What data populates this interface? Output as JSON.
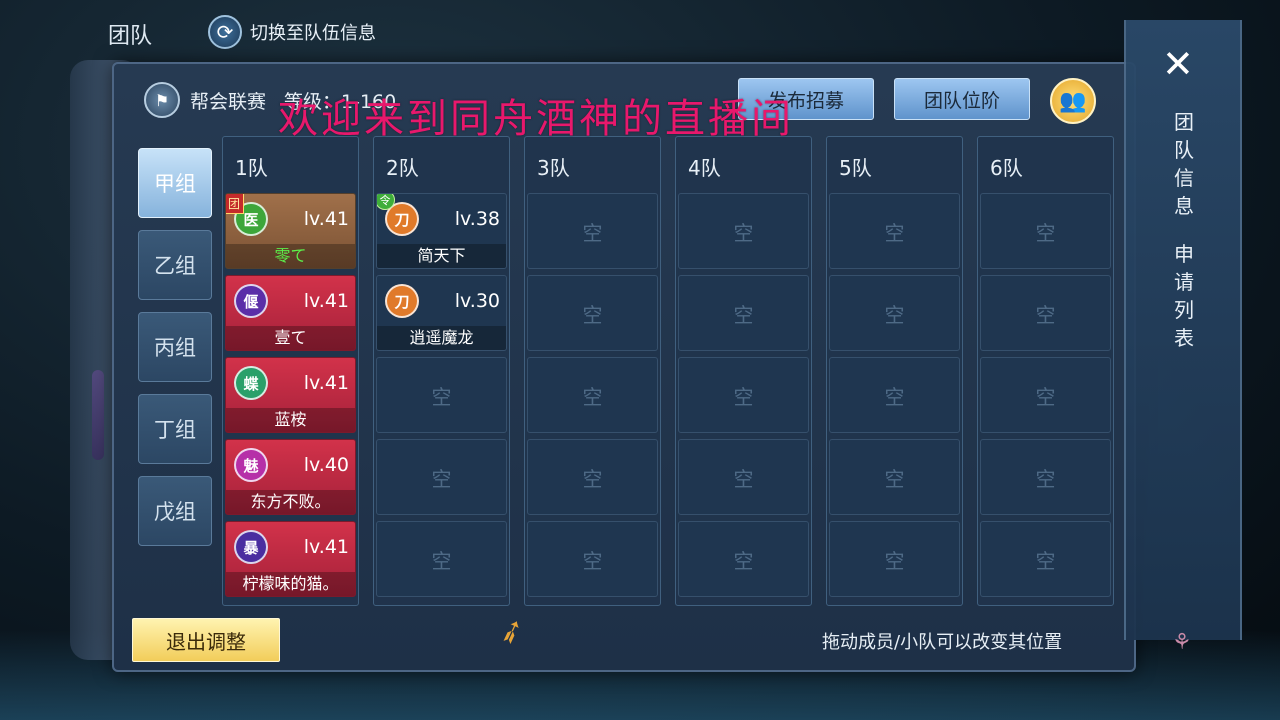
{
  "top": {
    "title": "团队",
    "switch_label": "切换至队伍信息",
    "switch_icon": "refresh-icon"
  },
  "panel": {
    "league": "帮会联赛",
    "level": "等级：1-160",
    "buttons": {
      "recruit": "发布招募",
      "rank": "团队位阶"
    }
  },
  "watermark": "欢迎来到同舟酒神的直播间",
  "groups": [
    "甲组",
    "乙组",
    "丙组",
    "丁组",
    "戊组"
  ],
  "teams": [
    {
      "name": "1队",
      "members": [
        {
          "avatar": "医",
          "level": "lv.41",
          "name": "零て",
          "style": "brown",
          "avatar_color": "#3da63a",
          "badge": "团"
        },
        {
          "avatar": "偃",
          "level": "lv.41",
          "name": "壹て",
          "style": "red",
          "avatar_color": "#5b2ea8"
        },
        {
          "avatar": "蝶",
          "level": "lv.41",
          "name": "蓝桉",
          "style": "red",
          "avatar_color": "#2aa06a"
        },
        {
          "avatar": "魅",
          "level": "lv.40",
          "name": "东方不败。",
          "style": "red",
          "avatar_color": "#b62fa8"
        },
        {
          "avatar": "暴",
          "level": "lv.41",
          "name": "柠檬味的猫。",
          "style": "red",
          "avatar_color": "#4a2ea0"
        }
      ]
    },
    {
      "name": "2队",
      "members": [
        {
          "avatar": "刀",
          "level": "lv.38",
          "name": "简天下",
          "style": "dark",
          "avatar_color": "#e07a2a",
          "badge": "令"
        },
        {
          "avatar": "刀",
          "level": "lv.30",
          "name": "逍遥魔龙",
          "style": "dark",
          "avatar_color": "#e07a2a"
        }
      ]
    },
    {
      "name": "3队",
      "members": []
    },
    {
      "name": "4队",
      "members": []
    },
    {
      "name": "5队",
      "members": []
    },
    {
      "name": "6队",
      "members": []
    }
  ],
  "empty_label": "空",
  "bottom": {
    "exit": "退出调整",
    "hint": "拖动成员/小队可以改变其位置"
  },
  "side": {
    "team_info": "团\n队\n信\n息",
    "apply_list": "申\n请\n列\n表",
    "close_icon": "close-icon"
  },
  "colors": {
    "accent_blue": "#86b3dc",
    "gold": "#f2cd5a",
    "red_card": "#d2324a",
    "brown_card": "#a0704a",
    "watermark": "#e8186c"
  }
}
